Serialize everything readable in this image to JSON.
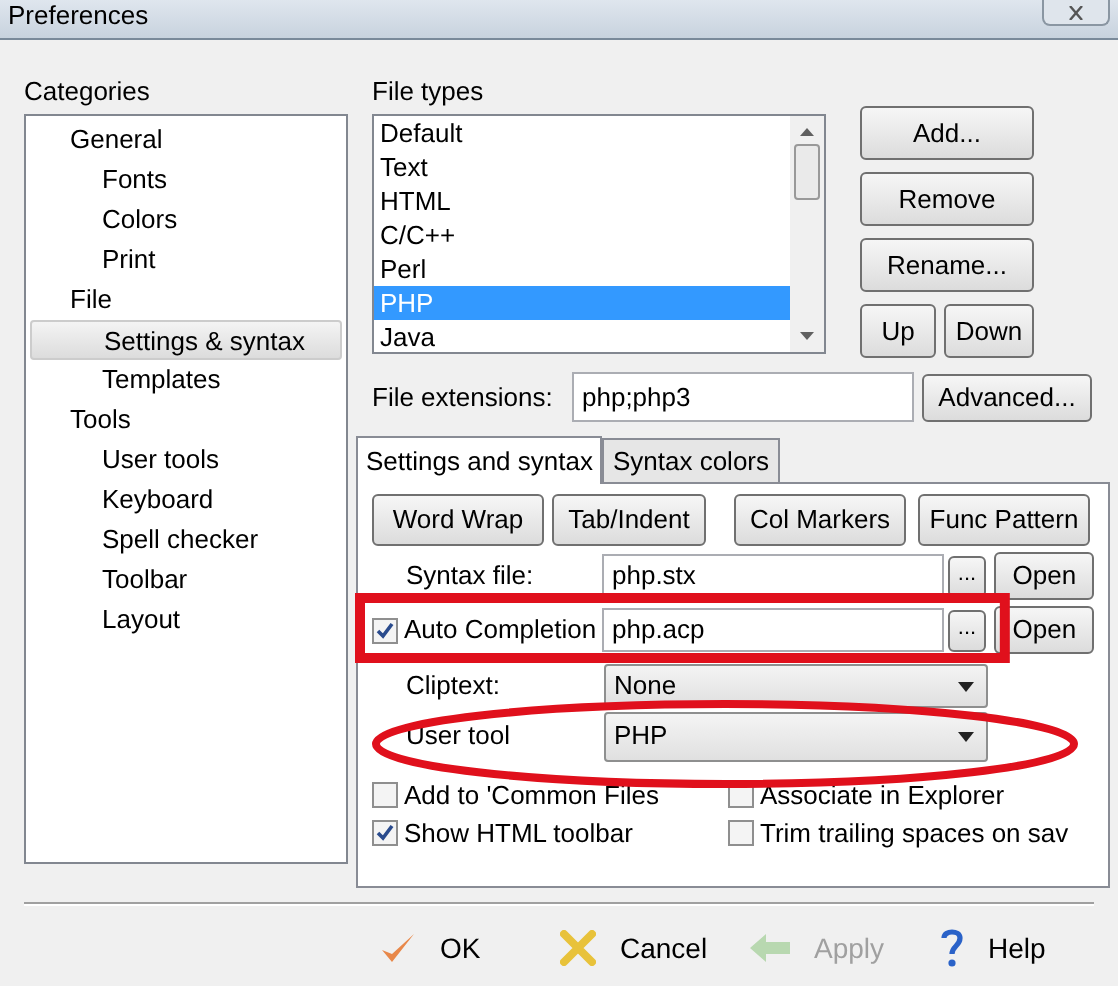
{
  "window": {
    "title": "Preferences"
  },
  "categories": {
    "label": "Categories",
    "items": [
      {
        "label": "General",
        "selected": false,
        "children": [
          {
            "label": "Fonts",
            "selected": false
          },
          {
            "label": "Colors",
            "selected": false
          },
          {
            "label": "Print",
            "selected": false
          }
        ]
      },
      {
        "label": "File",
        "selected": false,
        "children": [
          {
            "label": "Settings & syntax",
            "selected": true
          },
          {
            "label": "Templates",
            "selected": false
          }
        ]
      },
      {
        "label": "Tools",
        "selected": false,
        "children": [
          {
            "label": "User tools",
            "selected": false
          },
          {
            "label": "Keyboard",
            "selected": false
          },
          {
            "label": "Spell checker",
            "selected": false
          },
          {
            "label": "Toolbar",
            "selected": false
          },
          {
            "label": "Layout",
            "selected": false
          }
        ]
      }
    ]
  },
  "file_types": {
    "label": "File types",
    "items": [
      {
        "label": "Default",
        "selected": false
      },
      {
        "label": "Text",
        "selected": false
      },
      {
        "label": "HTML",
        "selected": false
      },
      {
        "label": "C/C++",
        "selected": false
      },
      {
        "label": "Perl",
        "selected": false
      },
      {
        "label": "PHP",
        "selected": true
      },
      {
        "label": "Java",
        "selected": false
      }
    ]
  },
  "file_type_buttons": [
    "Add...",
    "Remove",
    "Rename...",
    "Up",
    "Down"
  ],
  "file_extensions": {
    "label": "File extensions:",
    "value": "php;php3"
  },
  "advanced_button": "Advanced...",
  "tabs": [
    {
      "label": "Settings and syntax",
      "selected": true
    },
    {
      "label": "Syntax colors",
      "selected": false
    }
  ],
  "tab_buttons": [
    "Word Wrap",
    "Tab/Indent",
    "Col Markers",
    "Func Pattern"
  ],
  "file_rows": [
    {
      "kind": "label",
      "label": "Syntax file:",
      "value": "php.stx",
      "browse": "...",
      "open": "Open"
    },
    {
      "kind": "checkbox",
      "checked": true,
      "label": "Auto Completion",
      "value": "php.acp",
      "browse": "...",
      "open": "Open",
      "circled": true
    }
  ],
  "selects": [
    {
      "label": "Cliptext:",
      "value": "None"
    },
    {
      "label": "User tool",
      "value": "PHP",
      "circled": true
    }
  ],
  "options": [
    {
      "label": "Add to 'Common Files",
      "checked": false
    },
    {
      "label": "Associate in Explorer",
      "checked": false
    },
    {
      "label": "Show HTML toolbar",
      "checked": true
    },
    {
      "label": "Trim trailing spaces on sav",
      "checked": false
    }
  ],
  "footer_buttons": [
    {
      "kind": "ok",
      "label": "OK",
      "disabled": false
    },
    {
      "kind": "cancel",
      "label": "Cancel",
      "disabled": false
    },
    {
      "kind": "apply",
      "label": "Apply",
      "disabled": true
    },
    {
      "kind": "help",
      "label": "Help",
      "disabled": false
    }
  ]
}
